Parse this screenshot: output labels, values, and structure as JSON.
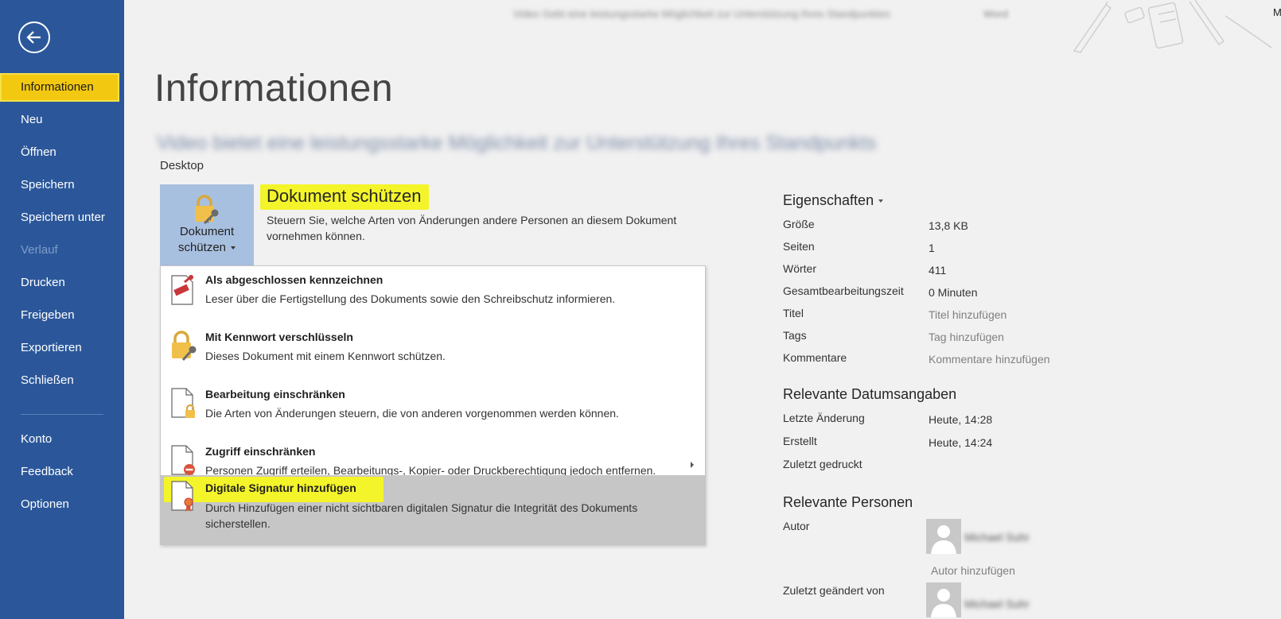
{
  "titlebar": {
    "document_title": "Video Gebt eine leistungsstarke Möglichkeit zur Unterstützung Ihres Standpunktes",
    "app_name": "Word",
    "corner_letter": "M"
  },
  "sidebar": {
    "items": [
      {
        "label": "Informationen"
      },
      {
        "label": "Neu"
      },
      {
        "label": "Öffnen"
      },
      {
        "label": "Speichern"
      },
      {
        "label": "Speichern unter"
      },
      {
        "label": "Verlauf"
      },
      {
        "label": "Drucken"
      },
      {
        "label": "Freigeben"
      },
      {
        "label": "Exportieren"
      },
      {
        "label": "Schließen"
      },
      {
        "label": "Konto"
      },
      {
        "label": "Feedback"
      },
      {
        "label": "Optionen"
      }
    ]
  },
  "main": {
    "page_title": "Informationen",
    "document_name": "Video bietet eine leistungsstarke Möglichkeit zur Unterstützung Ihres Standpunkts",
    "location": "Desktop",
    "protect": {
      "button_line1": "Dokument",
      "button_line2": "schützen",
      "heading": "Dokument schützen",
      "description": "Steuern Sie, welche Arten von Änderungen andere Personen an diesem Dokument vornehmen können."
    },
    "menu": [
      {
        "title": "Als abgeschlossen kennzeichnen",
        "description": "Leser über die Fertigstellung des Dokuments sowie den Schreibschutz informieren."
      },
      {
        "title": "Mit Kennwort verschlüsseln",
        "description": "Dieses Dokument mit einem Kennwort schützen."
      },
      {
        "title": "Bearbeitung einschränken",
        "description": "Die Arten von Änderungen steuern, die von anderen vorgenommen werden können."
      },
      {
        "title": "Zugriff einschränken",
        "description": "Personen Zugriff erteilen, Bearbeitungs-, Kopier- oder Druckberechtigung jedoch entfernen."
      },
      {
        "title": "Digitale Signatur hinzufügen",
        "description": "Durch Hinzufügen einer nicht sichtbaren digitalen Signatur die Integrität des Dokuments sicherstellen."
      }
    ]
  },
  "properties": {
    "heading": "Eigenschaften",
    "rows": [
      {
        "label": "Größe",
        "value": "13,8 KB"
      },
      {
        "label": "Seiten",
        "value": "1"
      },
      {
        "label": "Wörter",
        "value": "411"
      },
      {
        "label": "Gesamtbearbeitungszeit",
        "value": "0 Minuten"
      },
      {
        "label": "Titel",
        "value": "Titel hinzufügen"
      },
      {
        "label": "Tags",
        "value": "Tag hinzufügen"
      },
      {
        "label": "Kommentare",
        "value": "Kommentare hinzufügen"
      }
    ],
    "dates_heading": "Relevante Datumsangaben",
    "dates": [
      {
        "label": "Letzte Änderung",
        "value": "Heute, 14:28"
      },
      {
        "label": "Erstellt",
        "value": "Heute, 14:24"
      },
      {
        "label": "Zuletzt gedruckt",
        "value": ""
      }
    ],
    "people_heading": "Relevante Personen",
    "author_label": "Autor",
    "author_name": "Michael Suhr",
    "add_author": "Autor hinzufügen",
    "last_modified_label": "Zuletzt geändert von",
    "last_modified_name": "Michael Suhr"
  },
  "colors": {
    "sidebar": "#2b579a",
    "active_nav": "#f2c811",
    "highlight": "#f4f42a",
    "protect_button": "#a8c0e0"
  }
}
